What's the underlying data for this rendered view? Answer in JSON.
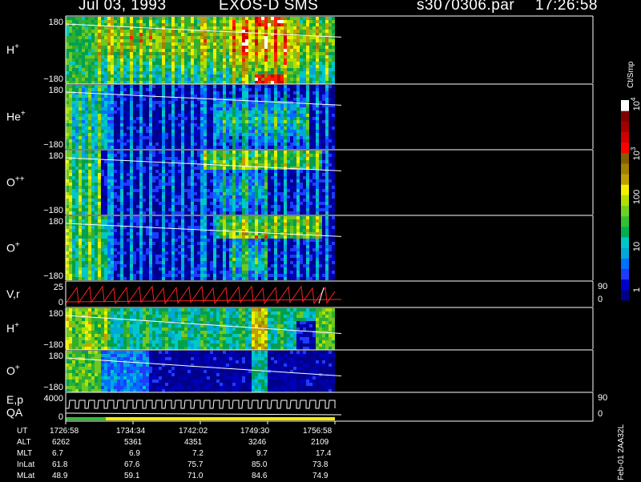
{
  "header": {
    "date": "Jul 03, 1993",
    "instrument": "EXOS-D SMS",
    "file": "s3070306.par",
    "time": "17:26:58"
  },
  "colorbar": {
    "unit_label": "Ct/Smp",
    "tick_labels": [
      "1",
      "10",
      "100",
      "10",
      "10"
    ],
    "tick_exps": [
      "",
      "",
      "",
      "3",
      "4"
    ],
    "colors": [
      "#00008b",
      "#0000cd",
      "#1e3cff",
      "#0070ff",
      "#00a8d8",
      "#00c8c8",
      "#00b050",
      "#30c030",
      "#70d020",
      "#b0e000",
      "#f0f000",
      "#c0a000",
      "#a08000",
      "#806000",
      "#ff0000",
      "#d00000",
      "#a00000",
      "#800000",
      "#ffffff"
    ]
  },
  "panels": [
    {
      "label": "H",
      "sup": "+",
      "ymax": "180",
      "ymin": "−180"
    },
    {
      "label": "He",
      "sup": "+",
      "ymax": "180",
      "ymin": "−180"
    },
    {
      "label": "O",
      "sup": "++",
      "ymax": "180",
      "ymin": "−180"
    },
    {
      "label": "O",
      "sup": "+",
      "ymax": "180",
      "ymin": "−180"
    },
    {
      "label": "V,r",
      "sup": "",
      "ymax": "25",
      "ymin": "0",
      "rmax": "90",
      "rmin": "0"
    },
    {
      "label": "H",
      "sup": "+",
      "ymax": "180",
      "ymin": "−180"
    },
    {
      "label": "O",
      "sup": "+",
      "ymax": "180",
      "ymin": "−180"
    },
    {
      "label": "E,p",
      "label2": "QA",
      "sup": "",
      "ymax": "4000",
      "ymin": "0",
      "rmax": "90",
      "rmin": "0"
    }
  ],
  "ut_table": {
    "rows": [
      {
        "label": "UT",
        "values": [
          "1726:58",
          "1734:34",
          "1742:02",
          "1749:30",
          "1756:58"
        ]
      },
      {
        "label": "ALT",
        "values": [
          "6262",
          "5361",
          "4351",
          "3246",
          "2109"
        ]
      },
      {
        "label": "MLT",
        "values": [
          "6.7",
          "6.9",
          "7.2",
          "9.7",
          "17.4"
        ]
      },
      {
        "label": "InLat",
        "values": [
          "61.8",
          "67.6",
          "75.7",
          "85.0",
          "73.8"
        ]
      },
      {
        "label": "MLat",
        "values": [
          "48.9",
          "59.1",
          "71.0",
          "84.6",
          "74.9"
        ]
      }
    ]
  },
  "side_label": "Feb-01 2AA32L"
}
